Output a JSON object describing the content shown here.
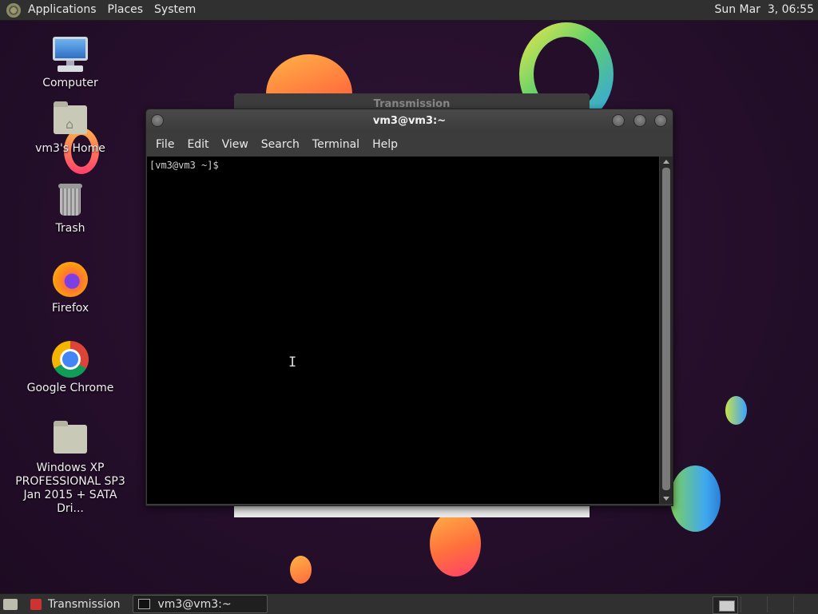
{
  "top_panel": {
    "menus": [
      "Applications",
      "Places",
      "System"
    ],
    "clock": "Sun Mar  3, 06:55"
  },
  "desktop_icons": [
    {
      "label": "Computer",
      "icon": "computer-icon"
    },
    {
      "label": "vm3's Home",
      "icon": "home-folder-icon"
    },
    {
      "label": "Trash",
      "icon": "trash-icon"
    },
    {
      "label": "Firefox",
      "icon": "firefox-icon"
    },
    {
      "label": "Google Chrome",
      "icon": "chrome-icon"
    },
    {
      "label": "Windows XP PROFESSIONAL SP3 Jan 2015 + SATA Dri...",
      "icon": "folder-icon"
    }
  ],
  "background_window": {
    "title": "Transmission"
  },
  "terminal": {
    "title": "vm3@vm3:~",
    "menu": [
      "File",
      "Edit",
      "View",
      "Search",
      "Terminal",
      "Help"
    ],
    "prompt": "[vm3@vm3 ~]$"
  },
  "taskbar": {
    "tasks": [
      {
        "label": "Transmission",
        "active": false
      },
      {
        "label": "vm3@vm3:~",
        "active": true
      }
    ]
  },
  "colors": {
    "panel": "#303030",
    "desktop_bg": "#240e2a",
    "terminal_bg": "#000000"
  }
}
